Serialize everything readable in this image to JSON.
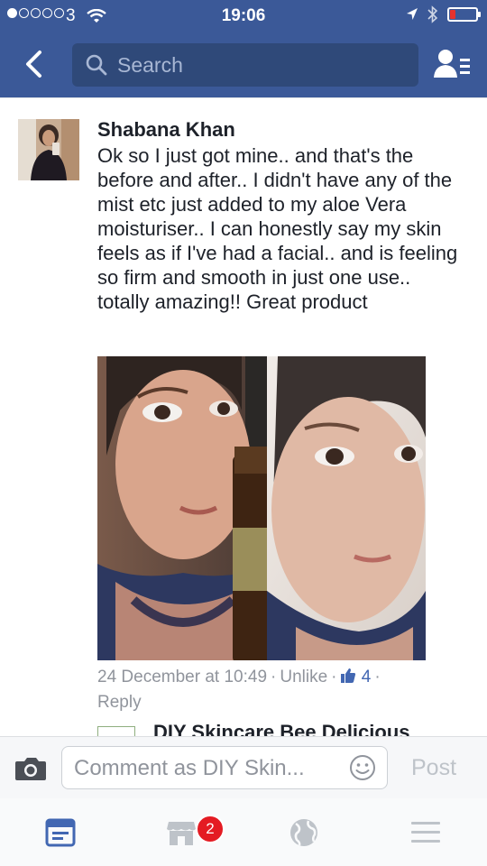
{
  "status_bar": {
    "signal_icon": "signal-dots-icon",
    "carrier": "3",
    "wifi_icon": "wifi-icon",
    "time": "19:06",
    "location_icon": "location-arrow-icon",
    "bluetooth_icon": "bluetooth-icon",
    "battery_icon": "battery-icon",
    "battery_level": 0.2
  },
  "nav": {
    "back_icon": "chevron-left-icon",
    "search_placeholder": "Search",
    "friends_icon": "friend-requests-icon"
  },
  "comment": {
    "author": "Shabana Khan",
    "text": "Ok so I just got mine.. and that's the before and after.. I didn't have any of the mist etc just added to my aloe Vera moisturiser.. I can honestly say my skin feels as if I've had a facial.. and is feeling so firm and smooth in just one use.. totally amazing!! Great product",
    "timestamp": "24 December at 10:49",
    "unlike_label": "Unlike",
    "like_count": "4",
    "reply_label": "Reply",
    "separator": "·"
  },
  "next_comment": {
    "author": "DIY Skincare Bee Delicious"
  },
  "composer": {
    "camera_icon": "camera-icon",
    "placeholder": "Comment as DIY Skin...",
    "emoji_icon": "smiley-icon",
    "post_label": "Post"
  },
  "tabbar": {
    "tabs": [
      {
        "icon": "news-feed-icon",
        "active": true
      },
      {
        "icon": "marketplace-icon",
        "badge": "2"
      },
      {
        "icon": "globe-icon"
      },
      {
        "icon": "menu-icon"
      }
    ]
  },
  "colors": {
    "brand": "#3b5998",
    "like_blue": "#4267b2",
    "badge_red": "#e41b23"
  }
}
